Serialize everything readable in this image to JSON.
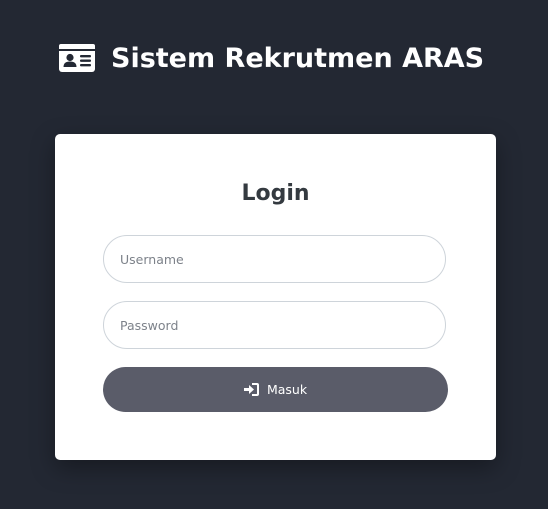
{
  "header": {
    "title": "Sistem Rekrutmen ARAS",
    "icon": "id-card-icon"
  },
  "login": {
    "title": "Login",
    "username_placeholder": "Username",
    "password_placeholder": "Password",
    "submit_label": "Masuk",
    "submit_icon": "sign-in-icon"
  },
  "colors": {
    "background": "#232833",
    "card": "#ffffff",
    "button": "#5a5c69",
    "title_text": "#343a40"
  }
}
